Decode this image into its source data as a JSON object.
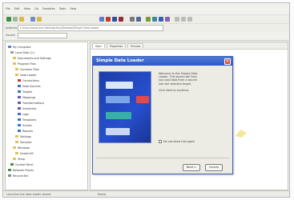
{
  "window": {
    "menu_items": [
      "File",
      "Edit",
      "View",
      "Go",
      "Favorites",
      "Tools",
      "Help"
    ],
    "address_label": "Address",
    "address_value": "C:\\Documents and Settings\\User\\Desktop\\Simple Data Loader",
    "address2_label": "Search",
    "status_left": "Launches the data loader wizard",
    "status_mid": "Ready"
  },
  "tree": {
    "items": [
      {
        "label": "My Computer",
        "color": "#5c7fc2"
      },
      {
        "label": "Local Disk (C:)",
        "color": "#9a9a9a"
      },
      {
        "label": "Documents and Settings",
        "color": "#e0c15a"
      },
      {
        "label": "Program Files",
        "color": "#e0c15a"
      },
      {
        "label": "Common Files",
        "color": "#e0c15a"
      },
      {
        "label": "Data Loader",
        "color": "#e0c15a"
      },
      {
        "label": "Connections",
        "color": "#c0392b"
      },
      {
        "label": "Data Sources",
        "color": "#3b73c8"
      },
      {
        "label": "Targets",
        "color": "#3b73c8"
      },
      {
        "label": "Mappings",
        "color": "#6a56b6"
      },
      {
        "label": "Transformations",
        "color": "#6a56b6"
      },
      {
        "label": "Schedules",
        "color": "#6a56b6"
      },
      {
        "label": "Logs",
        "color": "#3b73c8"
      },
      {
        "label": "Templates",
        "color": "#3b73c8"
      },
      {
        "label": "Scripts",
        "color": "#3b73c8"
      },
      {
        "label": "Reports",
        "color": "#3b73c8"
      },
      {
        "label": "Settings",
        "color": "#e0c15a"
      },
      {
        "label": "Samples",
        "color": "#e0c15a"
      },
      {
        "label": "Windows",
        "color": "#e0c15a"
      },
      {
        "label": "System32",
        "color": "#e0c15a"
      },
      {
        "label": "Temp",
        "color": "#e0c15a"
      },
      {
        "label": "Control Panel",
        "color": "#4f8a3b"
      },
      {
        "label": "Network Places",
        "color": "#4f8a3b"
      },
      {
        "label": "Recycle Bin",
        "color": "#7f8c8d"
      }
    ]
  },
  "tabs": [
    "Start",
    "Properties",
    "Preview"
  ],
  "dialog": {
    "title": "Simple Data Loader",
    "close_glyph": "×",
    "text_lines": [
      "Welcome to the Simple Data",
      "Loader. This wizard will help",
      "you load data from a source",
      "into the selected target.",
      "",
      "Click Next to continue."
    ],
    "checkbox_label": "Do not show this again",
    "next_label": "Next >",
    "cancel_label": "Cancel",
    "art_colors": [
      "#d9e7f7",
      "#7aa6e8",
      "#e04a4a",
      "#37b1a6",
      "#c8d8f5"
    ]
  }
}
